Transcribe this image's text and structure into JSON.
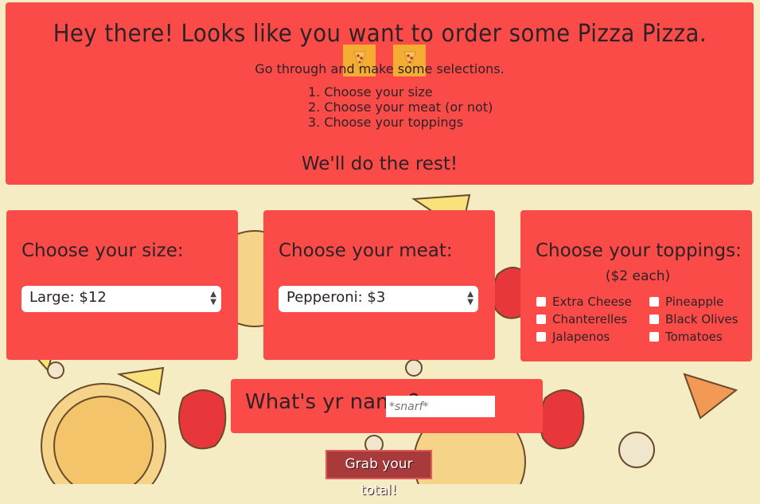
{
  "header": {
    "title": "Hey there! Looks like you want to order some Pizza Pizza.",
    "subtitle": "Go through and make some selections.",
    "steps": [
      "1. Choose your size",
      "2. Choose your meat (or not)",
      "3. Choose your toppings"
    ],
    "closing": "We'll do the rest!",
    "icon_left": "pizza-slice-icon",
    "icon_right": "pizza-slice-icon"
  },
  "size_card": {
    "title": "Choose your size:",
    "selected": "Large: $12"
  },
  "meat_card": {
    "title": "Choose your meat:",
    "selected": "Pepperoni: $3"
  },
  "toppings_card": {
    "title": "Choose your toppings:",
    "subtitle": "($2 each)",
    "items": [
      {
        "label": "Extra Cheese",
        "checked": false
      },
      {
        "label": "Chanterelles",
        "checked": false
      },
      {
        "label": "Jalapenos",
        "checked": false
      },
      {
        "label": "Pineapple",
        "checked": false
      },
      {
        "label": "Black Olives",
        "checked": false
      },
      {
        "label": "Tomatoes",
        "checked": false
      }
    ]
  },
  "name_card": {
    "label": "What's yr name?",
    "placeholder": "*snarf*"
  },
  "submit": {
    "label": "Grab your total!"
  },
  "colors": {
    "panel": "#fb4b49",
    "background": "#f6ecc4",
    "button": "#a83a3b",
    "text": "#2e2226"
  }
}
